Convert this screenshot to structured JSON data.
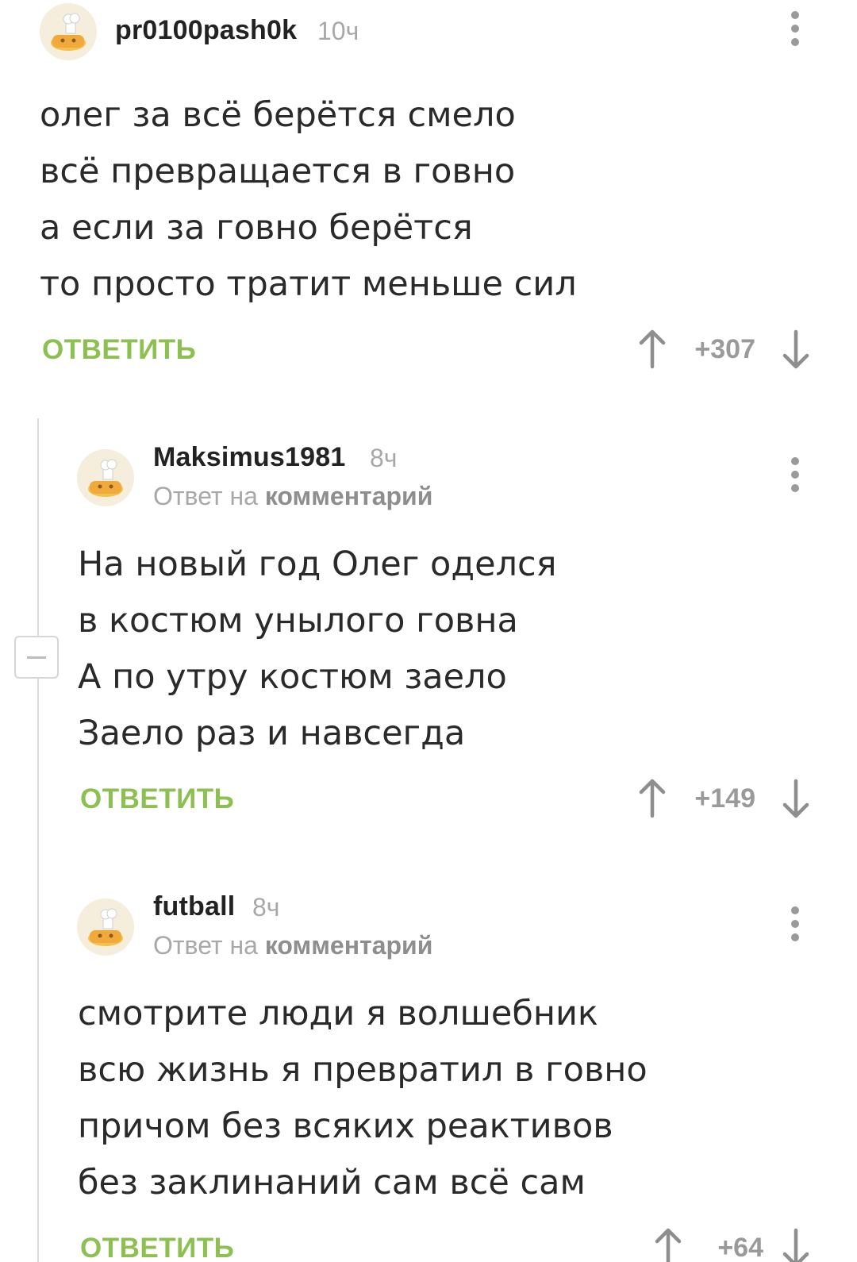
{
  "comments": [
    {
      "username": "pr0100pash0k",
      "time": "10ч",
      "lines": [
        "олег за всё берётся смело",
        "всё превращается в говно",
        "а если за говно берётся",
        "то просто тратит меньше сил"
      ],
      "reply_label": "ОТВЕТИТЬ",
      "rating": "+307"
    },
    {
      "username": "Maksimus1981",
      "time": "8ч",
      "reply_to_prefix": "Ответ на",
      "reply_to_link": "комментарий",
      "lines": [
        "На новый год Олег оделся",
        "в костюм унылого говна",
        "А по утру костюм заело",
        "Заело раз и навсегда"
      ],
      "reply_label": "ОТВЕТИТЬ",
      "rating": "+149"
    },
    {
      "username": "futball",
      "time": "8ч",
      "reply_to_prefix": "Ответ на",
      "reply_to_link": "комментарий",
      "lines": [
        "смотрите люди я волшебник",
        "всю жизнь я превратил в говно",
        "причом без всяких реактивов",
        "без заклинаний сам всё сам"
      ],
      "reply_label": "ОТВЕТИТЬ",
      "rating": "+64"
    }
  ],
  "icons": {
    "avatar": "default-chef-avatar-icon",
    "menu": "more-vertical-icon",
    "upvote": "arrow-up-icon",
    "downvote": "arrow-down-icon",
    "collapse": "minus-icon"
  },
  "colors": {
    "reply_green": "#8cc152",
    "muted_gray": "#a8a8a8",
    "thread_line": "#dcdcdc"
  }
}
